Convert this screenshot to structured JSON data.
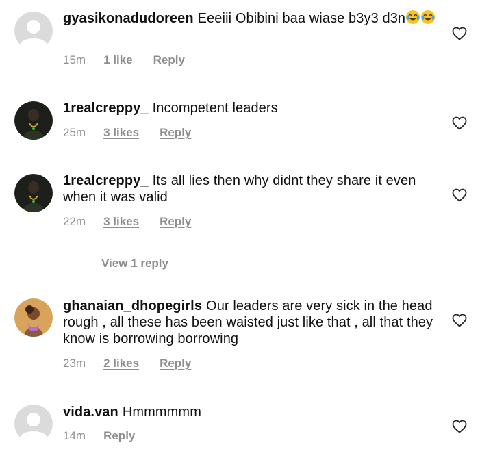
{
  "comments": [
    {
      "username": "gyasikonadudoreen",
      "text": "Eeeiii Obibini baa wiase b3y3 d3n",
      "emoji_count": 2,
      "time": "15m",
      "likes": "1 like",
      "reply_label": "Reply",
      "avatar": "default-avatar-icon"
    },
    {
      "username": "1realcreppy_",
      "text": "Incompetent leaders",
      "time": "25m",
      "likes": "3 likes",
      "reply_label": "Reply",
      "avatar": "profile-photo"
    },
    {
      "username": "1realcreppy_",
      "text": "Its all lies then why didnt they share it even when it was valid",
      "time": "22m",
      "likes": "3 likes",
      "reply_label": "Reply",
      "avatar": "profile-photo"
    },
    {
      "username": "ghanaian_dhopegirls",
      "text": "Our leaders are very sick in the head rough , all these has been waisted just like that , all that they know is borrowing borrowing",
      "time": "23m",
      "likes": "2 likes",
      "reply_label": "Reply",
      "avatar": "profile-photo"
    },
    {
      "username": "vida.van",
      "text": "Hmmmmmm",
      "time": "14m",
      "reply_label": "Reply",
      "avatar": "default-avatar-icon"
    }
  ],
  "view_replies_label": "View 1 reply",
  "icons": {
    "like": "heart-outline-icon",
    "emoji": "face-with-tears-of-joy-emoji"
  },
  "colors": {
    "text": "#111111",
    "meta": "#8e8e8e",
    "avatar_default": "#dbdbdb"
  }
}
